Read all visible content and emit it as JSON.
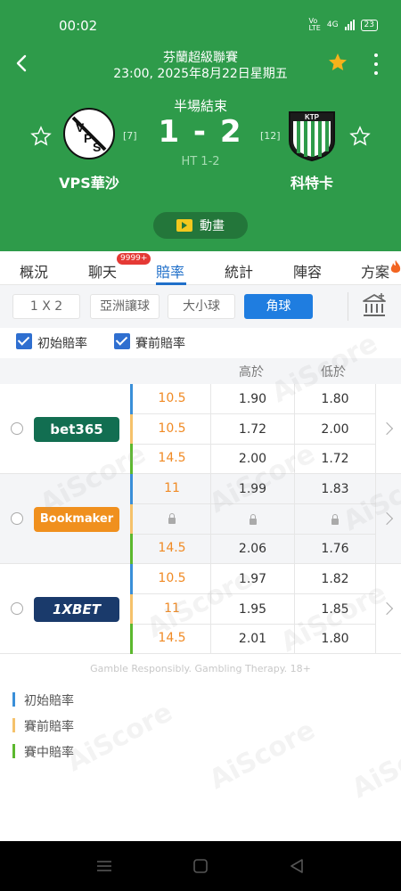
{
  "status": {
    "time": "00:02",
    "network": "4G",
    "battery": "23"
  },
  "header": {
    "league": "芬蘭超級聯賽",
    "datetime": "23:00, 2025年8月22日星期五",
    "status": "半場結束",
    "score": "1 - 2",
    "halftime": "HT 1-2",
    "home": {
      "name": "VPS華沙",
      "rank": "[7]"
    },
    "away": {
      "name": "科特卡",
      "rank": "[12]"
    },
    "animation_label": "動畫"
  },
  "tabs": [
    {
      "label": "概況"
    },
    {
      "label": "聊天"
    },
    {
      "label": "賠率"
    },
    {
      "label": "統計"
    },
    {
      "label": "陣容"
    },
    {
      "label": "方案"
    }
  ],
  "chat_badge": "9999+",
  "filter": [
    "1 X 2",
    "亞洲讓球",
    "大小球",
    "角球"
  ],
  "checks": [
    "初始賠率",
    "賽前賠率"
  ],
  "table": {
    "headers": {
      "over": "高於",
      "under": "低於"
    },
    "groups": [
      {
        "bookmaker": "bet365",
        "rows": [
          {
            "line": "10.5",
            "over": "1.90",
            "under": "1.80"
          },
          {
            "line": "10.5",
            "over": "1.72",
            "under": "2.00"
          },
          {
            "line": "14.5",
            "over": "2.00",
            "under": "1.72"
          }
        ]
      },
      {
        "bookmaker": "Bookmaker",
        "rows": [
          {
            "line": "11",
            "over": "1.99",
            "under": "1.83"
          },
          {
            "line": "",
            "over": "",
            "under": ""
          },
          {
            "line": "14.5",
            "over": "2.06",
            "under": "1.76"
          }
        ]
      },
      {
        "bookmaker": "1XBET",
        "rows": [
          {
            "line": "10.5",
            "over": "1.97",
            "under": "1.82"
          },
          {
            "line": "11",
            "over": "1.95",
            "under": "1.85"
          },
          {
            "line": "14.5",
            "over": "2.01",
            "under": "1.80"
          }
        ]
      }
    ]
  },
  "gamble_note": "Gamble Responsibly. Gambling Therapy. 18+",
  "legend": [
    {
      "label": "初始賠率",
      "color": "#3a8fd8"
    },
    {
      "label": "賽前賠率",
      "color": "#f5c26b"
    },
    {
      "label": "賽中賠率",
      "color": "#5cb82e"
    }
  ],
  "watermark": "AiScore",
  "colors": {
    "header_green": "#2e9b4a",
    "accent_blue": "#1f7de0",
    "line_orange": "#f08a24"
  }
}
